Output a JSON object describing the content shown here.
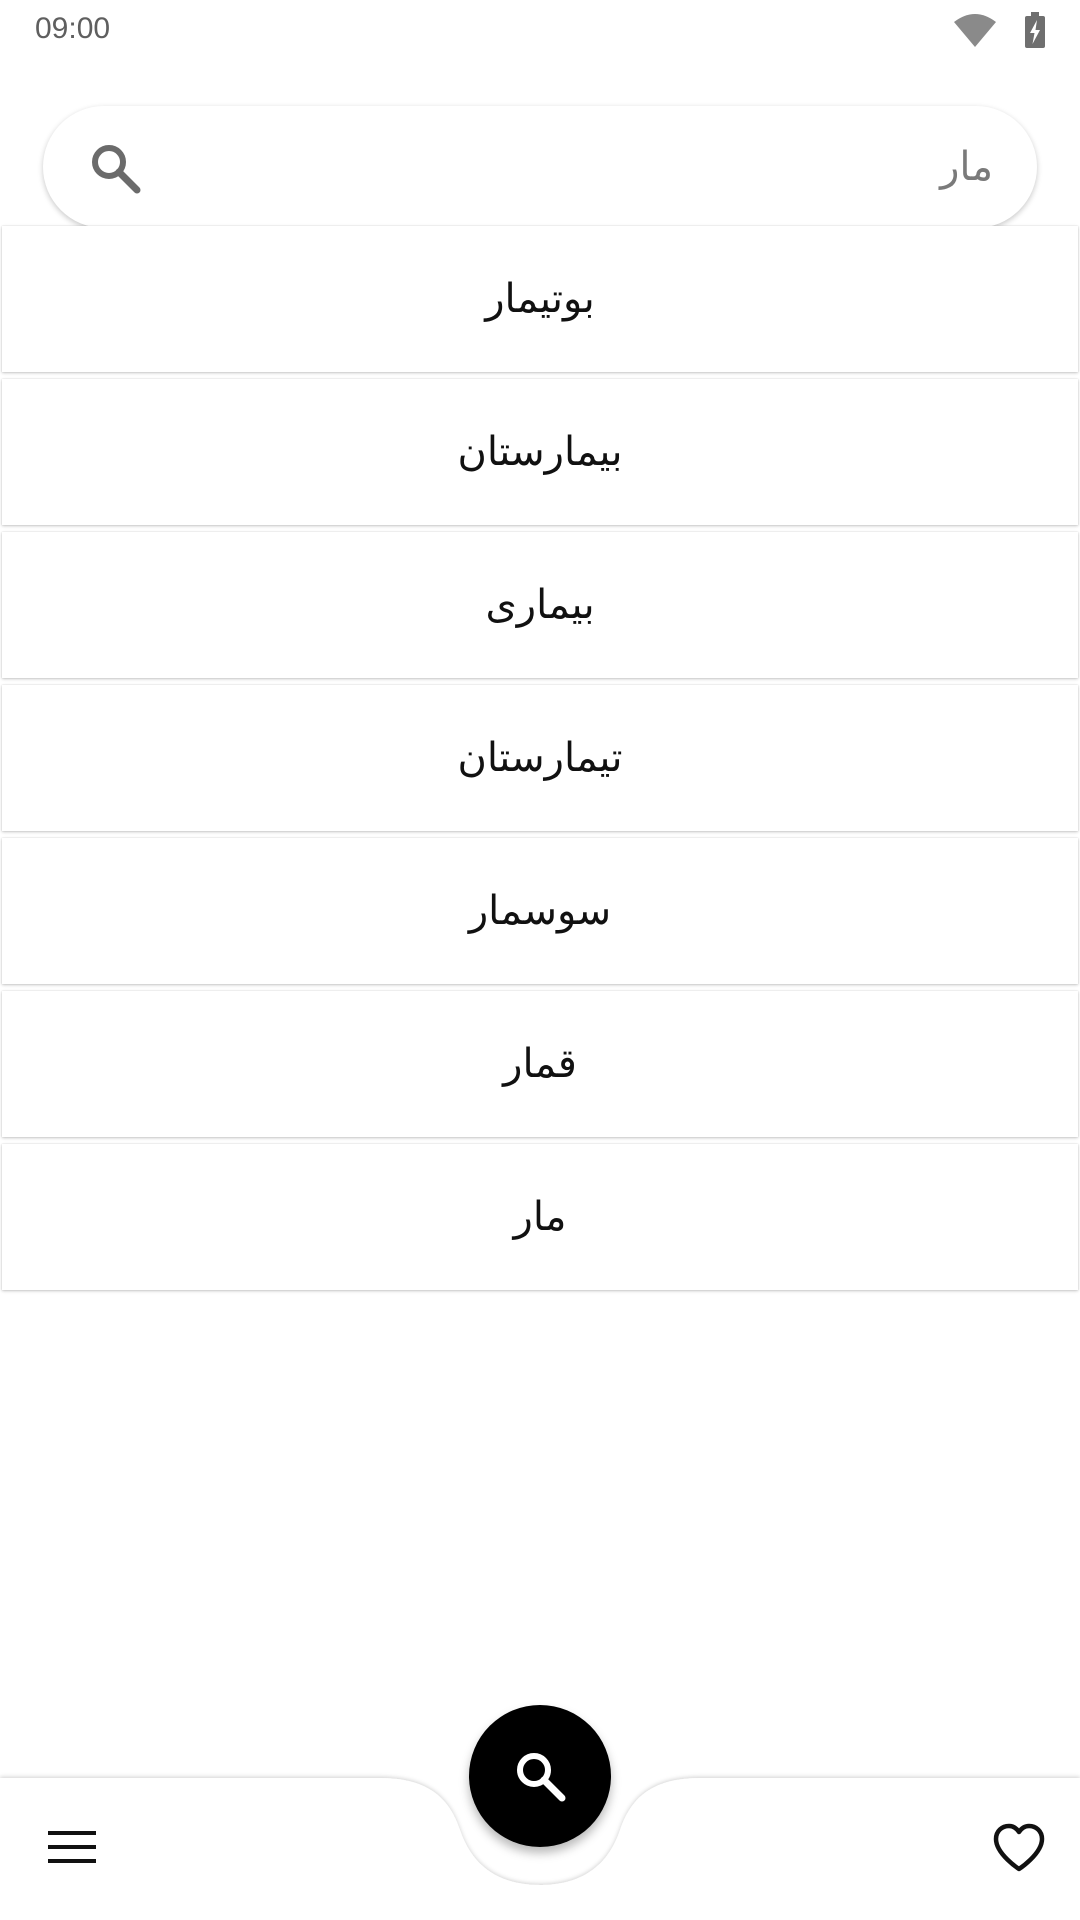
{
  "status_bar": {
    "time": "09:00",
    "wifi_icon": "wifi-icon",
    "battery_icon": "battery-charging-icon"
  },
  "search": {
    "value": "مار",
    "icon": "search-icon"
  },
  "results": [
    {
      "label": "بوتیمار"
    },
    {
      "label": "بیمارستان"
    },
    {
      "label": "بیماری"
    },
    {
      "label": "تیمارستان"
    },
    {
      "label": "سوسمار"
    },
    {
      "label": "قمار"
    },
    {
      "label": "مار"
    }
  ],
  "bottom_bar": {
    "menu_icon": "hamburger-menu-icon",
    "fab_icon": "search-icon",
    "favorites_icon": "heart-icon"
  },
  "colors": {
    "fab": "#000000",
    "status_icons": "#8a8a8a",
    "background": "#ffffff"
  }
}
